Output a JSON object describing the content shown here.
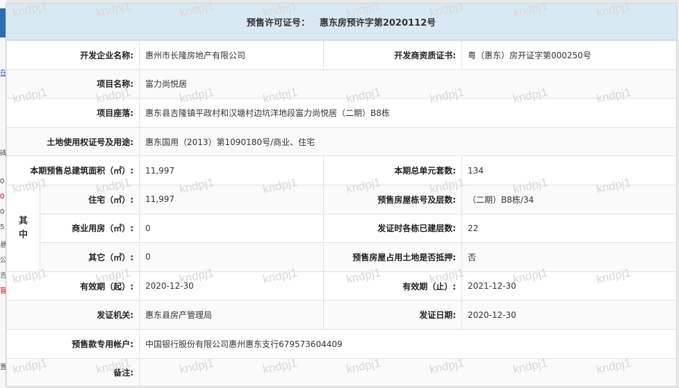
{
  "header": {
    "permit_label": "预售许可证号：",
    "permit_value": "惠东房预许字第2020112号"
  },
  "fields": {
    "developer_label": "开发企业名称:",
    "developer_value": "惠州市长隆房地产有限公司",
    "qualification_label": "开发商资质证书:",
    "qualification_value": "粤（惠东）房开证字第000250号",
    "project_name_label": "项目名称:",
    "project_name_value": "富力尚悦居",
    "location_label": "项目座落:",
    "location_value": "惠东县吉隆镇平政村和汉塘村边坑洋地段富力尚悦居（二期）B8栋",
    "land_label": "土地使用权证号及用途:",
    "land_value": "惠东国用（2013）第1090180号/商业、住宅",
    "total_area_label": "本期预售总建筑面积（㎡）:",
    "total_area_value": "11,997",
    "total_units_label": "本期总单元套数:",
    "total_units_value": "134",
    "side_label": "其 中",
    "residential_label": "住宅（㎡）:",
    "residential_value": "11,997",
    "building_label": "预售房屋栋号及层数:",
    "building_value": "（二期）B8栋/34",
    "commercial_label": "商业用房（㎡）:",
    "commercial_value": "0",
    "floors_built_label": "发证时各栋已建层数:",
    "floors_built_value": "22",
    "other_label": "其它（㎡）:",
    "other_value": "0",
    "mortgage_label": "预售房屋占用土地是否抵押:",
    "mortgage_value": "否",
    "valid_from_label": "有效期（起）:",
    "valid_from_value": "2020-12-30",
    "valid_to_label": "有效期（止）:",
    "valid_to_value": "2021-12-30",
    "authority_label": "发证机关:",
    "authority_value": "惠东县房产管理局",
    "issue_date_label": "发证日期:",
    "issue_date_value": "2020-12-30",
    "account_label": "预售款专用帐户:",
    "account_value": "中国银行股份有限公司惠州惠东支行679573604409",
    "remarks_label": "备注:",
    "remarks_value": ""
  },
  "watermark_text": "kndpj1",
  "background_glyphs": [
    "在",
    "碑",
    "0",
    "0",
    "0",
    "5",
    "悬",
    "公",
    "吉",
    "盲",
    "置"
  ],
  "colors": {
    "title_bg": "#d9e9f4",
    "accent_blue": "#2a6fb3"
  }
}
